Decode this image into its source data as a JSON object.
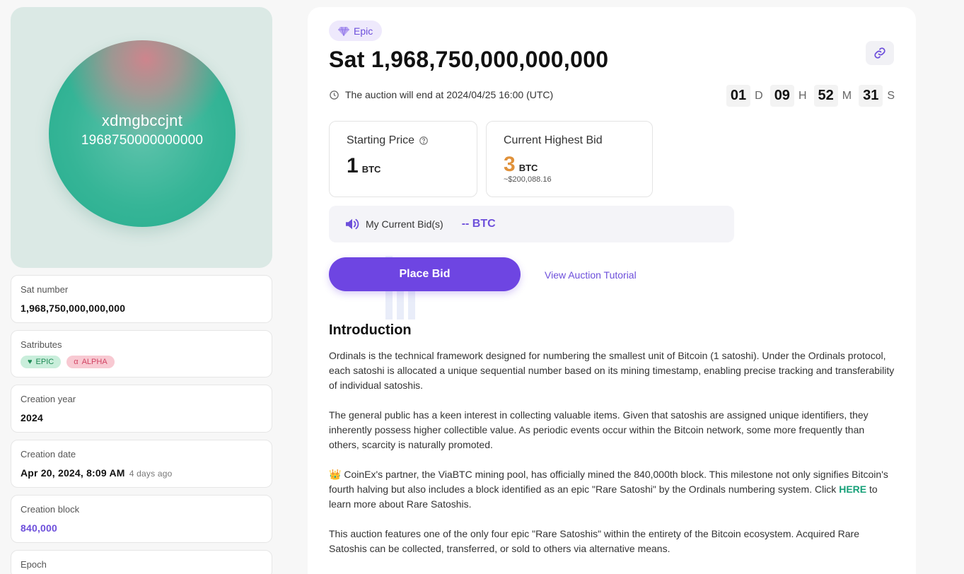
{
  "hero": {
    "name": "xdmgbccjnt",
    "number": "1968750000000000"
  },
  "details": {
    "sat_number": {
      "label": "Sat number",
      "value": "1,968,750,000,000,000"
    },
    "satributes": {
      "label": "Satributes",
      "chips": [
        {
          "label": "EPIC",
          "icon": "diamond-icon"
        },
        {
          "label": "ALPHA",
          "icon": "alpha-icon"
        }
      ]
    },
    "creation_year": {
      "label": "Creation year",
      "value": "2024"
    },
    "creation_date": {
      "label": "Creation date",
      "value": "Apr 20, 2024, 8:09 AM",
      "ago": "4 days ago"
    },
    "creation_block": {
      "label": "Creation block",
      "value": "840,000"
    },
    "epoch": {
      "label": "Epoch"
    }
  },
  "main": {
    "badge": "Epic",
    "title": "Sat 1,968,750,000,000,000",
    "auction_end": "The auction will end at 2024/04/25 16:00 (UTC)",
    "countdown": [
      {
        "value": "01",
        "unit": "D"
      },
      {
        "value": "09",
        "unit": "H"
      },
      {
        "value": "52",
        "unit": "M"
      },
      {
        "value": "31",
        "unit": "S"
      }
    ],
    "starting_price": {
      "label": "Starting Price",
      "value": "1",
      "currency": "BTC"
    },
    "highest_bid": {
      "label": "Current Highest Bid",
      "value": "3",
      "currency": "BTC",
      "usd": "~$200,088.16"
    },
    "my_bid": {
      "label": "My Current Bid(s)",
      "value": "-- BTC"
    },
    "place_bid": "Place Bid",
    "tutorial": "View Auction Tutorial",
    "intro_heading": "Introduction",
    "intro_p1": "Ordinals is the technical framework designed for numbering the smallest unit of Bitcoin (1 satoshi). Under the Ordinals protocol, each satoshi is allocated a unique sequential number based on its mining timestamp, enabling precise tracking and transferability of individual satoshis.",
    "intro_p2": "The general public has a keen interest in collecting valuable items. Given that satoshis are assigned unique identifiers, they inherently possess higher collectible value. As periodic events occur within the Bitcoin network, some more frequently than others, scarcity is naturally promoted.",
    "intro_p3_emoji": "👑",
    "intro_p3_a": " CoinEx's partner, the ViaBTC mining pool, has officially mined the 840,000th block. This milestone not only signifies Bitcoin's fourth halving but also includes a block identified as an epic \"Rare Satoshi\" by the Ordinals numbering system. Click ",
    "intro_p3_link": "HERE",
    "intro_p3_b": " to learn more about Rare Satoshis.",
    "intro_p4": "This auction features one of the only four epic \"Rare Satoshis\" within the entirety of the Bitcoin ecosystem. Acquired Rare Satoshis can be collected, transferred, or sold to others via alternative means."
  },
  "colors": {
    "accent": "#6e45e2",
    "orange": "#e0913a",
    "green": "#16a078"
  }
}
